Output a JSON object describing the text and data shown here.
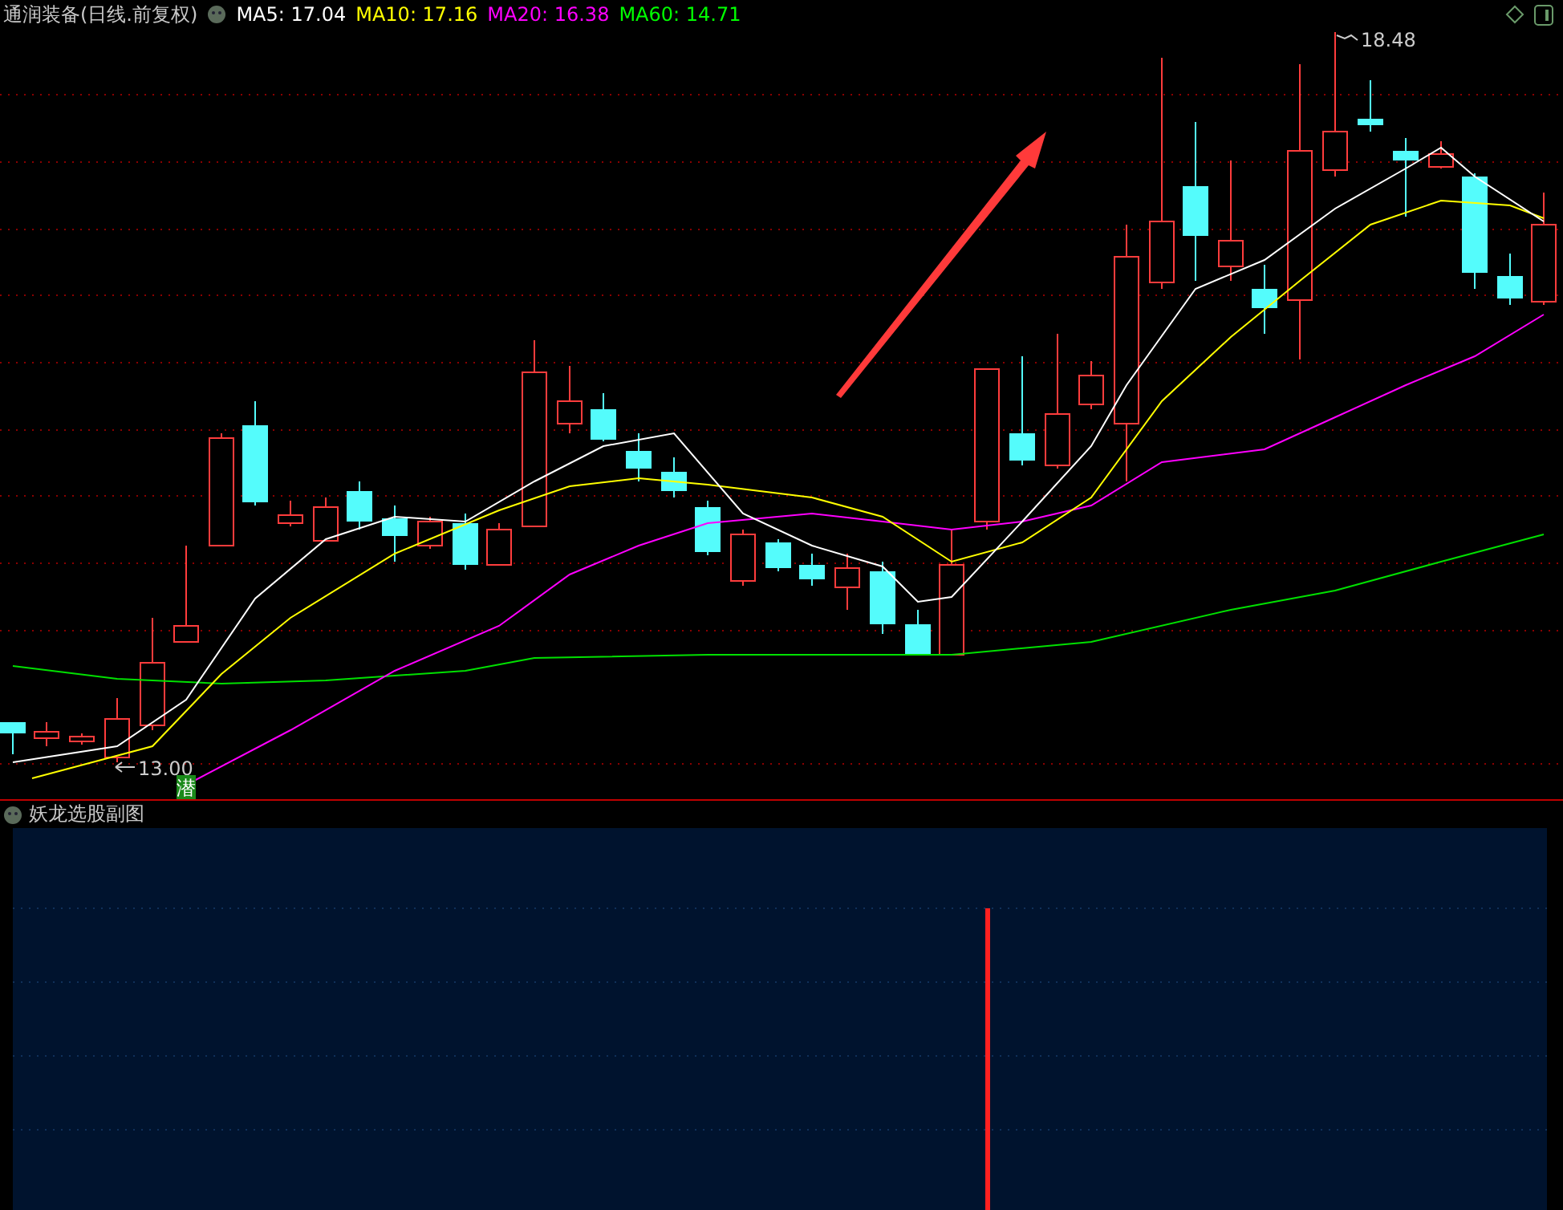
{
  "title": "通润装备(日线.前复权)",
  "ma_legend": [
    {
      "label": "MA5: 17.04",
      "color": "#ffffff"
    },
    {
      "label": "MA10: 17.16",
      "color": "#ffff00"
    },
    {
      "label": "MA20: 16.38",
      "color": "#ff00ff"
    },
    {
      "label": "MA60: 14.71",
      "color": "#00ff00"
    }
  ],
  "high_label": "18.48",
  "low_label": "13.00",
  "signal_marker": "潜",
  "subchart": {
    "title": "妖龙选股副图"
  }
}
